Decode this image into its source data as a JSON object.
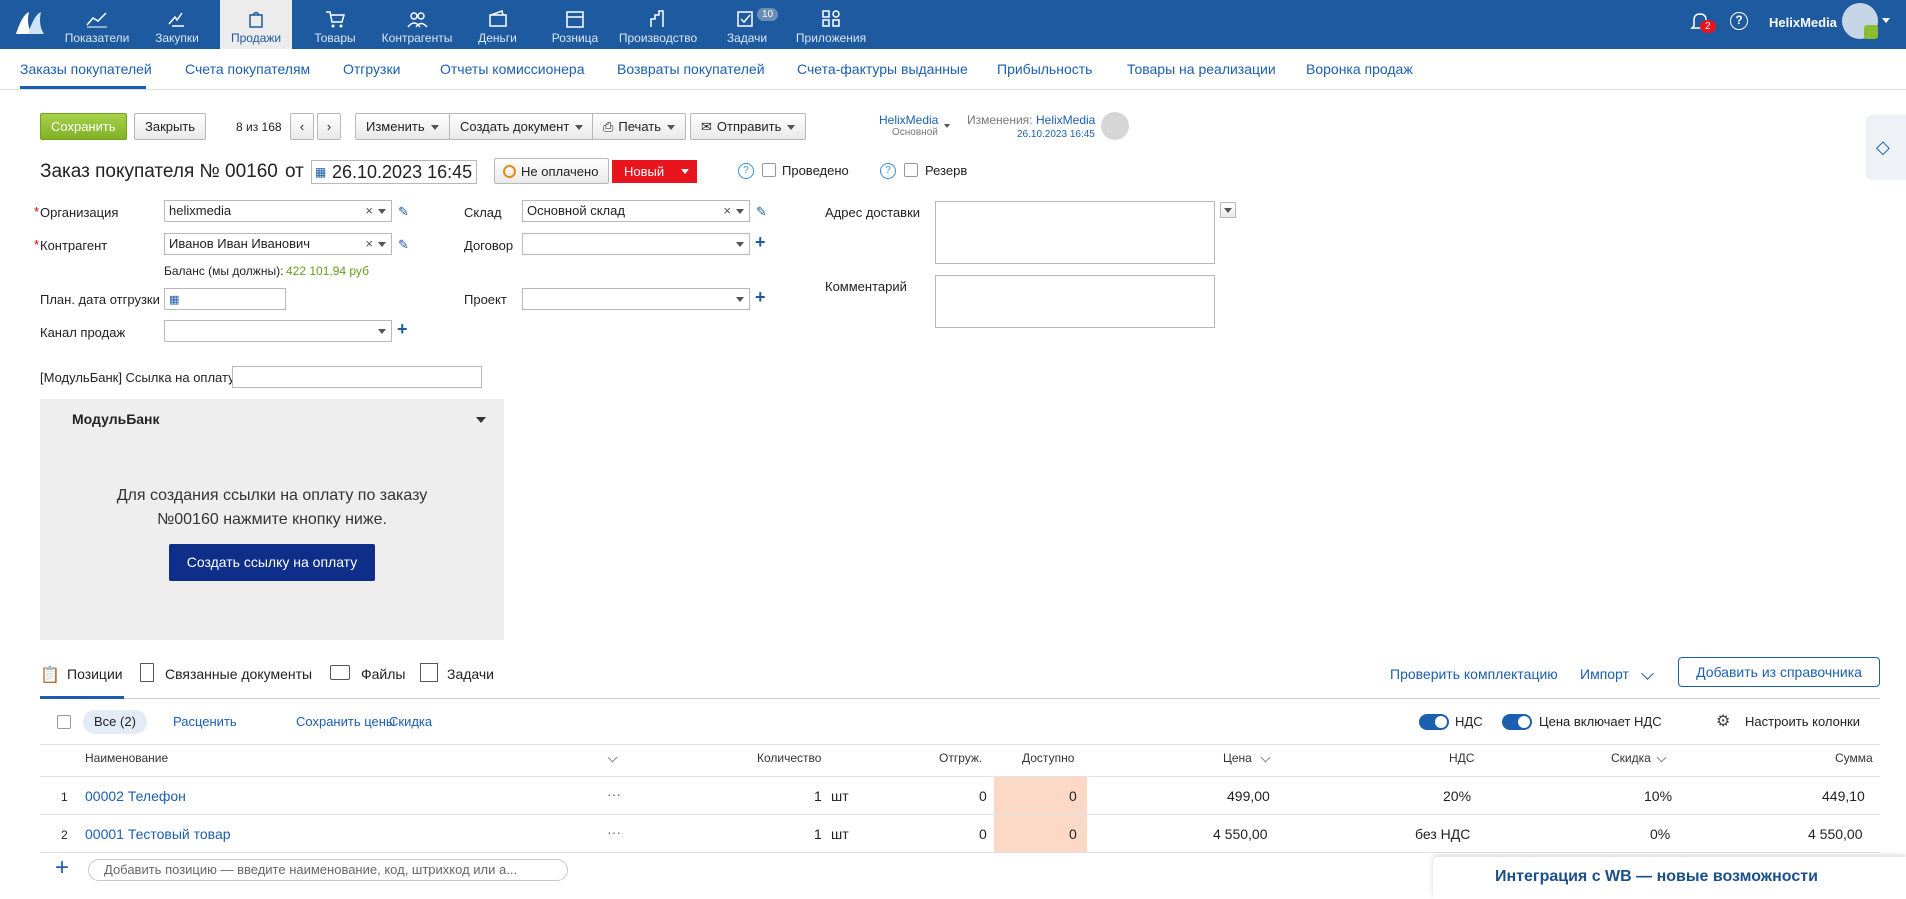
{
  "topnav": {
    "items": [
      {
        "label": "Показатели",
        "icon": "chart-icon"
      },
      {
        "label": "Закупки",
        "icon": "hand-icon"
      },
      {
        "label": "Продажи",
        "icon": "bag-icon"
      },
      {
        "label": "Товары",
        "icon": "cart-icon"
      },
      {
        "label": "Контрагенты",
        "icon": "people-icon"
      },
      {
        "label": "Деньги",
        "icon": "wallet-icon"
      },
      {
        "label": "Розница",
        "icon": "shop-icon"
      },
      {
        "label": "Производство",
        "icon": "factory-icon"
      },
      {
        "label": "Задачи",
        "icon": "tasks-icon"
      },
      {
        "label": "Приложения",
        "icon": "apps-icon"
      }
    ],
    "tasks_badge": "10",
    "notifications_badge": "2",
    "help": "?",
    "user": "HelixMedia"
  },
  "subnav": [
    "Заказы покупателей",
    "Счета покупателям",
    "Отгрузки",
    "Отчеты комиссионера",
    "Возвраты покупателей",
    "Счета-фактуры выданные",
    "Прибыльность",
    "Товары на реализации",
    "Воронка продаж"
  ],
  "toolbar": {
    "save": "Сохранить",
    "close": "Закрыть",
    "counter": "8 из 168",
    "change": "Изменить",
    "create_doc": "Создать документ",
    "print": "Печать",
    "send": "Отправить",
    "owner": "HelixMedia",
    "owner_sub": "Основной",
    "changes_label": "Изменения:",
    "changes_user": "HelixMedia",
    "changes_date": "26.10.2023 16:45"
  },
  "doc": {
    "title": "Заказ покупателя №",
    "number": "00160",
    "from": "от",
    "date": "26.10.2023 16:45",
    "payment_status": "Не оплачено",
    "status": "Новый",
    "help": "?",
    "posted": "Проведено",
    "reserve": "Резерв"
  },
  "form": {
    "org_label": "Организация",
    "org_value": "helixmedia",
    "contractor_label": "Контрагент",
    "contractor_value": "Иванов Иван Иванович",
    "balance_label": "Баланс (мы должны):",
    "balance_value": "422 101,94 руб",
    "ship_date_label": "План. дата отгрузки",
    "channel_label": "Канал продаж",
    "warehouse_label": "Склад",
    "warehouse_value": "Основной склад",
    "contract_label": "Договор",
    "project_label": "Проект",
    "address_label": "Адрес доставки",
    "comment_label": "Комментарий",
    "modulbank_link_label": "[МодульБанк] Ссылка на оплату"
  },
  "modulbank": {
    "title": "МодульБанк",
    "text1": "Для создания ссылки на оплату по заказу",
    "text2": "№00160 нажмите кнопку ниже.",
    "button": "Создать ссылку на оплату"
  },
  "tabs": {
    "positions": "Позиции",
    "linked": "Связанные документы",
    "files": "Файлы",
    "tasks": "Задачи",
    "check": "Проверить комплектацию",
    "import": "Импорт",
    "add_ref": "Добавить из справочника"
  },
  "subbar": {
    "all": "Все (2)",
    "reprice": "Расценить",
    "save_prices": "Сохранить цены",
    "discount": "Скидка",
    "vat": "НДС",
    "price_incl_vat": "Цена включает НДС",
    "columns": "Настроить колонки"
  },
  "table": {
    "headers": {
      "name": "Наименование",
      "qty": "Количество",
      "shipped": "Отгруж.",
      "available": "Доступно",
      "price": "Цена",
      "vat": "НДС",
      "discount": "Скидка",
      "sum": "Сумма"
    },
    "rows": [
      {
        "n": "1",
        "name": "00002 Телефон",
        "more": "···",
        "qty": "1",
        "unit": "шт",
        "shipped": "0",
        "available": "0",
        "price": "499,00",
        "vat": "20%",
        "discount": "10%",
        "sum": "449,10"
      },
      {
        "n": "2",
        "name": "00001 Тестовый товар",
        "more": "···",
        "qty": "1",
        "unit": "шт",
        "shipped": "0",
        "available": "0",
        "price": "4 550,00",
        "vat": "без НДС",
        "discount": "0%",
        "sum": "4 550,00"
      }
    ],
    "add_placeholder": "Добавить позицию — введите наименование, код, штрихкод или а..."
  },
  "banner": "Интеграция с WB — новые возможности",
  "colors": {
    "topbar": "#1e5aa0",
    "accent": "#1b5fae",
    "status_new": "#e8141e",
    "save": "#8cbd2f",
    "available_bg": "#fbd9c6",
    "modulbank_btn": "#0f2e8a"
  }
}
